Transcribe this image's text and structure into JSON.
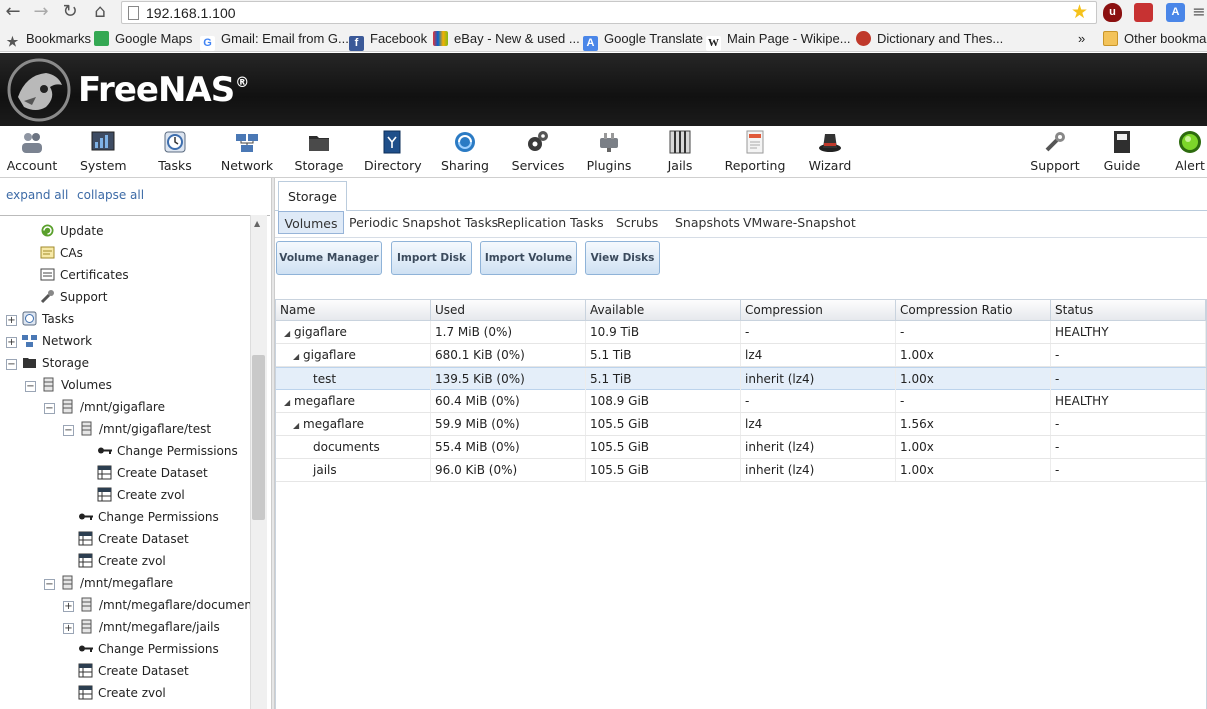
{
  "browser": {
    "url": "192.168.1.100",
    "bookmarks": [
      {
        "label": "Bookmarks",
        "icon": "star-icon"
      },
      {
        "label": "Google Maps",
        "icon": "maps-icon"
      },
      {
        "label": "Gmail: Email from G...",
        "icon": "google-icon"
      },
      {
        "label": "Facebook",
        "icon": "facebook-icon"
      },
      {
        "label": "eBay - New & used ...",
        "icon": "ebay-icon"
      },
      {
        "label": "Google Translate",
        "icon": "translate-icon"
      },
      {
        "label": "Main Page - Wikipe...",
        "icon": "wikipedia-icon"
      },
      {
        "label": "Dictionary and Thes...",
        "icon": "dictionary-icon"
      }
    ],
    "overflow_chevron": "»",
    "other_bookmarks": "Other bookmarks"
  },
  "app": {
    "name": "FreeNAS",
    "trademark": "®"
  },
  "toolbar": [
    {
      "label": "Account",
      "icon": "account-icon"
    },
    {
      "label": "System",
      "icon": "system-icon"
    },
    {
      "label": "Tasks",
      "icon": "tasks-icon"
    },
    {
      "label": "Network",
      "icon": "network-icon"
    },
    {
      "label": "Storage",
      "icon": "storage-icon"
    },
    {
      "label": "Directory",
      "icon": "directory-icon"
    },
    {
      "label": "Sharing",
      "icon": "sharing-icon"
    },
    {
      "label": "Services",
      "icon": "services-icon"
    },
    {
      "label": "Plugins",
      "icon": "plugins-icon"
    },
    {
      "label": "Jails",
      "icon": "jails-icon"
    },
    {
      "label": "Reporting",
      "icon": "reporting-icon"
    },
    {
      "label": "Wizard",
      "icon": "wizard-icon"
    },
    {
      "label": "Support",
      "icon": "support-icon"
    },
    {
      "label": "Guide",
      "icon": "guide-icon"
    },
    {
      "label": "Alert",
      "icon": "alert-icon"
    }
  ],
  "sidebar": {
    "expand_all": "expand all",
    "collapse_all": "collapse all",
    "tree": [
      {
        "label": "Update",
        "icon": "update-icon"
      },
      {
        "label": "CAs",
        "icon": "ca-icon"
      },
      {
        "label": "Certificates",
        "icon": "certificate-icon"
      },
      {
        "label": "Support",
        "icon": "support-icon"
      },
      {
        "label": "Tasks",
        "icon": "tasks-icon",
        "expander": "+"
      },
      {
        "label": "Network",
        "icon": "network-icon",
        "expander": "+"
      },
      {
        "label": "Storage",
        "icon": "storage-icon",
        "expander": "−"
      },
      {
        "label": "Volumes",
        "icon": "volume-icon",
        "expander": "−"
      },
      {
        "label": "/mnt/gigaflare",
        "icon": "volume-icon",
        "expander": "−"
      },
      {
        "label": "/mnt/gigaflare/test",
        "icon": "volume-icon",
        "expander": "−"
      },
      {
        "label": "Change Permissions",
        "icon": "key-icon"
      },
      {
        "label": "Create Dataset",
        "icon": "dataset-icon"
      },
      {
        "label": "Create zvol",
        "icon": "zvol-icon"
      },
      {
        "label": "Change Permissions",
        "icon": "key-icon"
      },
      {
        "label": "Create Dataset",
        "icon": "dataset-icon"
      },
      {
        "label": "Create zvol",
        "icon": "zvol-icon"
      },
      {
        "label": "/mnt/megaflare",
        "icon": "volume-icon",
        "expander": "−"
      },
      {
        "label": "/mnt/megaflare/document",
        "icon": "volume-icon",
        "expander": "+"
      },
      {
        "label": "/mnt/megaflare/jails",
        "icon": "volume-icon",
        "expander": "+"
      },
      {
        "label": "Change Permissions",
        "icon": "key-icon"
      },
      {
        "label": "Create Dataset",
        "icon": "dataset-icon"
      },
      {
        "label": "Create zvol",
        "icon": "zvol-icon"
      }
    ]
  },
  "main": {
    "tab": "Storage",
    "subtabs": [
      "Volumes",
      "Periodic Snapshot Tasks",
      "Replication Tasks",
      "Scrubs",
      "Snapshots",
      "VMware-Snapshot"
    ],
    "buttons": [
      "Volume Manager",
      "Import Disk",
      "Import Volume",
      "View Disks"
    ],
    "columns": [
      "Name",
      "Used",
      "Available",
      "Compression",
      "Compression Ratio",
      "Status"
    ],
    "rows": [
      {
        "name": "gigaflare",
        "used": "1.7 MiB (0%)",
        "available": "10.9 TiB",
        "compression": "-",
        "ratio": "-",
        "status": "HEALTHY"
      },
      {
        "name": "gigaflare",
        "used": "680.1 KiB (0%)",
        "available": "5.1 TiB",
        "compression": "lz4",
        "ratio": "1.00x",
        "status": "-"
      },
      {
        "name": "test",
        "used": "139.5 KiB (0%)",
        "available": "5.1 TiB",
        "compression": "inherit (lz4)",
        "ratio": "1.00x",
        "status": "-"
      },
      {
        "name": "megaflare",
        "used": "60.4 MiB (0%)",
        "available": "108.9 GiB",
        "compression": "-",
        "ratio": "-",
        "status": "HEALTHY"
      },
      {
        "name": "megaflare",
        "used": "59.9 MiB (0%)",
        "available": "105.5 GiB",
        "compression": "lz4",
        "ratio": "1.56x",
        "status": "-"
      },
      {
        "name": "documents",
        "used": "55.4 MiB (0%)",
        "available": "105.5 GiB",
        "compression": "inherit (lz4)",
        "ratio": "1.00x",
        "status": "-"
      },
      {
        "name": "jails",
        "used": "96.0 KiB (0%)",
        "available": "105.5 GiB",
        "compression": "inherit (lz4)",
        "ratio": "1.00x",
        "status": "-"
      }
    ],
    "tree_toggle_glyph": "◢"
  }
}
